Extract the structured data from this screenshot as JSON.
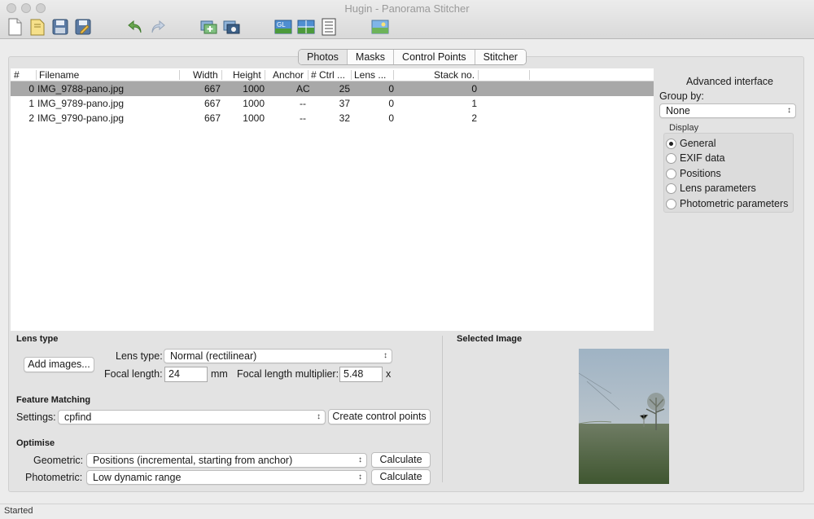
{
  "window": {
    "title": "Hugin - Panorama Stitcher"
  },
  "toolbar": {
    "icons": [
      "new-project-icon",
      "open-project-icon",
      "save-icon",
      "save-as-icon",
      "undo-icon",
      "redo-icon",
      "add-images-icon",
      "add-time-series-icon",
      "fast-preview-icon",
      "preview-icon",
      "layout-icon",
      "control-points-icon"
    ]
  },
  "tabs": [
    {
      "label": "Photos",
      "active": true
    },
    {
      "label": "Masks",
      "active": false
    },
    {
      "label": "Control Points",
      "active": false
    },
    {
      "label": "Stitcher",
      "active": false
    }
  ],
  "table": {
    "headers": {
      "num": "#",
      "filename": "Filename",
      "width": "Width",
      "height": "Height",
      "anchor": "Anchor",
      "ctrl": "# Ctrl ...",
      "lens": "Lens ...",
      "stack": "Stack no."
    },
    "rows": [
      {
        "num": "0",
        "filename": "IMG_9788-pano.jpg",
        "width": "667",
        "height": "1000",
        "anchor": "AC",
        "ctrl": "25",
        "lens": "0",
        "stack": "0"
      },
      {
        "num": "1",
        "filename": "IMG_9789-pano.jpg",
        "width": "667",
        "height": "1000",
        "anchor": "--",
        "ctrl": "37",
        "lens": "0",
        "stack": "1"
      },
      {
        "num": "2",
        "filename": "IMG_9790-pano.jpg",
        "width": "667",
        "height": "1000",
        "anchor": "--",
        "ctrl": "32",
        "lens": "0",
        "stack": "2"
      }
    ],
    "selected_row": 0
  },
  "side": {
    "advanced": "Advanced interface",
    "group_by_label": "Group by:",
    "group_by_value": "None",
    "display_label": "Display",
    "display_options": [
      "General",
      "EXIF data",
      "Positions",
      "Lens parameters",
      "Photometric parameters"
    ],
    "display_selected": "General"
  },
  "lens": {
    "section": "Lens type",
    "add_images": "Add images...",
    "type_label": "Lens type:",
    "type_value": "Normal (rectilinear)",
    "focal_label": "Focal length:",
    "focal_value": "24",
    "focal_unit": "mm",
    "multiplier_label": "Focal length multiplier:",
    "multiplier_value": "5.48",
    "multiplier_unit": "x"
  },
  "feature": {
    "section": "Feature Matching",
    "settings_label": "Settings:",
    "settings_value": "cpfind",
    "create_button": "Create control points"
  },
  "optimise": {
    "section": "Optimise",
    "geometric_label": "Geometric:",
    "geometric_value": "Positions (incremental, starting from anchor)",
    "photometric_label": "Photometric:",
    "photometric_value": "Low dynamic range",
    "calculate": "Calculate"
  },
  "preview": {
    "section": "Selected Image"
  },
  "status": {
    "text": "Started"
  }
}
